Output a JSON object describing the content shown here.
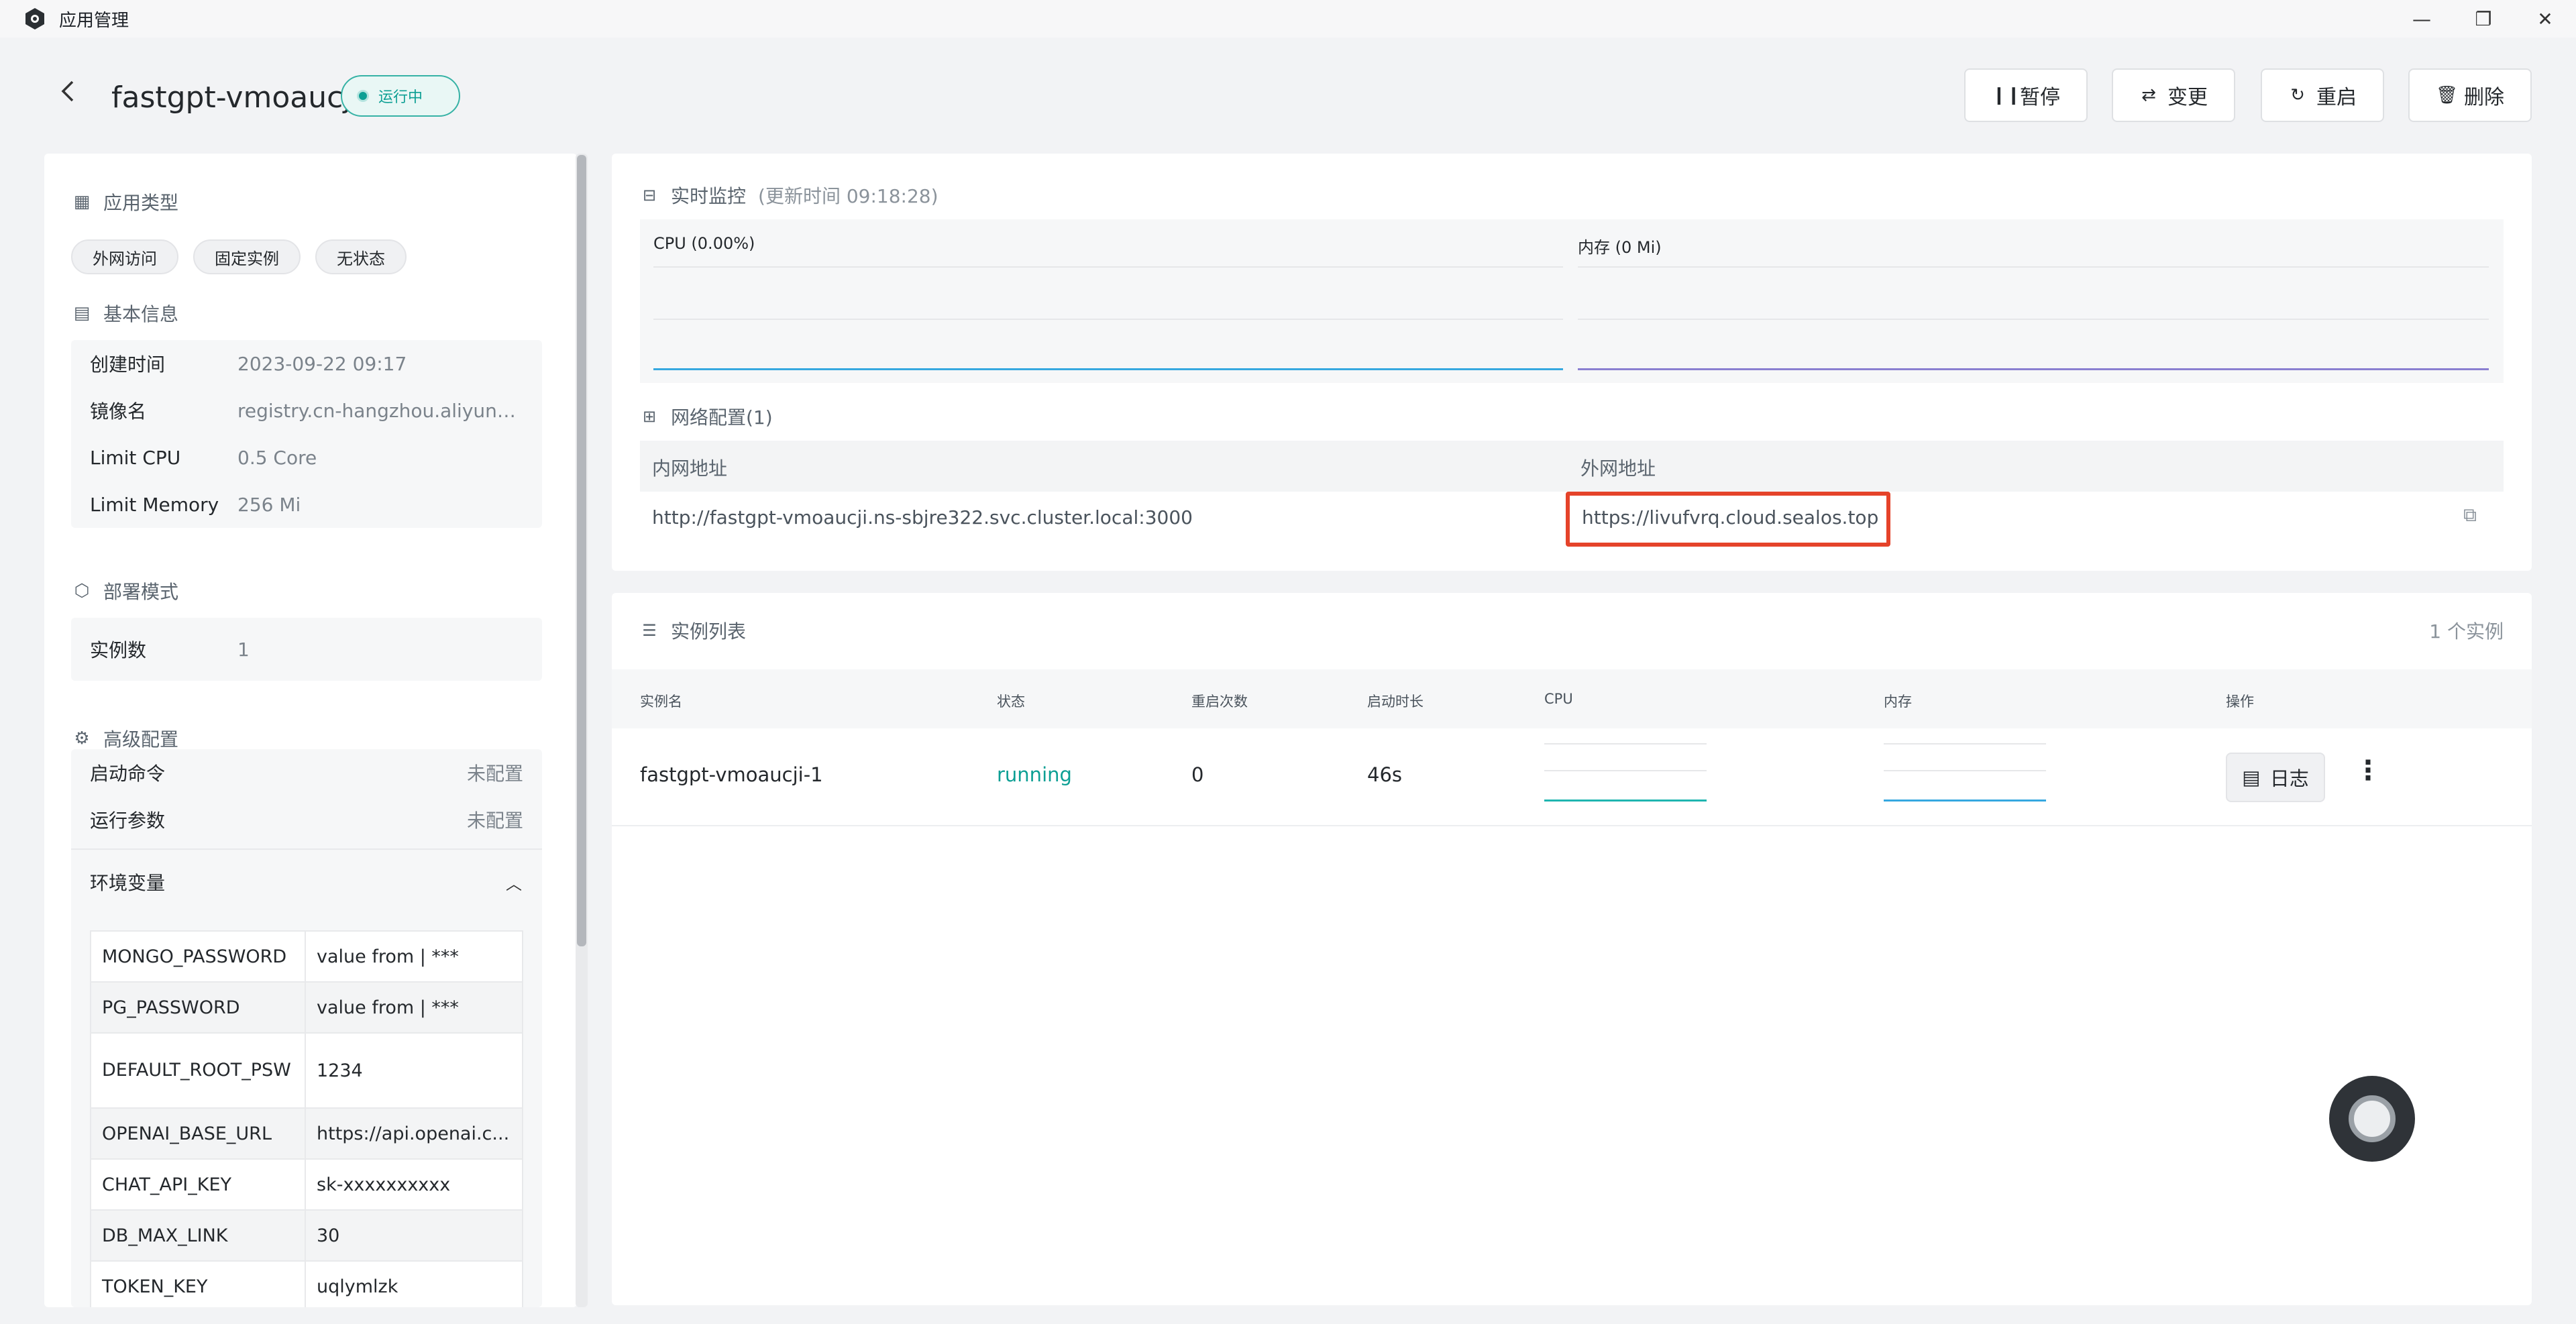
{
  "window": {
    "title": "应用管理",
    "controls": [
      "—",
      "❐",
      "✕"
    ]
  },
  "app": {
    "name": "fastgpt-vmoaucji",
    "status": "运行中"
  },
  "header_buttons": [
    {
      "name": "pause-button",
      "icon": "pause-icon",
      "glyph": "❙❙",
      "label": "暂停"
    },
    {
      "name": "change-button",
      "icon": "swap-icon",
      "glyph": "⇄",
      "label": "变更"
    },
    {
      "name": "restart-button",
      "icon": "restart-icon",
      "glyph": "↻",
      "label": "重启"
    },
    {
      "name": "delete-button",
      "icon": "trash-icon",
      "glyph": "🗑",
      "label": "删除"
    }
  ],
  "left": {
    "app_type": {
      "title": "应用类型",
      "tags": [
        "外网访问",
        "固定实例",
        "无状态"
      ]
    },
    "basic_info": {
      "title": "基本信息",
      "rows": [
        {
          "k": "创建时间",
          "v": "2023-09-22 09:17"
        },
        {
          "k": "镜像名",
          "v": "registry.cn-hangzhou.aliyuncs..."
        },
        {
          "k": "Limit CPU",
          "v": "0.5 Core"
        },
        {
          "k": "Limit Memory",
          "v": "256 Mi"
        }
      ]
    },
    "deploy": {
      "title": "部署模式",
      "rows": [
        {
          "k": "实例数",
          "v": "1"
        }
      ]
    },
    "advanced": {
      "title": "高级配置",
      "rows": [
        {
          "k": "启动命令",
          "v": "未配置"
        },
        {
          "k": "运行参数",
          "v": "未配置"
        }
      ],
      "env_title": "环境变量",
      "env": [
        {
          "k": "MONGO_PASSWORD",
          "v": "value from | ***"
        },
        {
          "k": "PG_PASSWORD",
          "v": "value from | ***"
        },
        {
          "k": "DEFAULT_ROOT_PSW",
          "v": "1234"
        },
        {
          "k": "OPENAI_BASE_URL",
          "v": "https://api.openai.c..."
        },
        {
          "k": "CHAT_API_KEY",
          "v": "sk-xxxxxxxxxx"
        },
        {
          "k": "DB_MAX_LINK",
          "v": "30"
        },
        {
          "k": "TOKEN_KEY",
          "v": "uqlymlzk"
        }
      ]
    }
  },
  "monitor": {
    "title": "实时监控",
    "updated": "(更新时间 09:18:28)",
    "cpu_label": "CPU  (0.00%)",
    "mem_label": "内存  (0 Mi)",
    "cpu_color": "#36a8e0",
    "mem_color": "#8a7fd1"
  },
  "network": {
    "title": "网络配置(1)",
    "internal_head": "内网地址",
    "external_head": "外网地址",
    "internal": "http://fastgpt-vmoaucji.ns-sbjre322.svc.cluster.local:3000",
    "external": "https://livufvrq.cloud.sealos.top",
    "highlight_color": "#e5432a"
  },
  "instances": {
    "title": "实例列表",
    "count": "1 个实例",
    "headers": [
      "实例名",
      "状态",
      "重启次数",
      "启动时长",
      "CPU",
      "内存",
      "操作"
    ],
    "rows": [
      {
        "name": "fastgpt-vmoaucji-1",
        "status": "running",
        "restarts": "0",
        "uptime": "46s",
        "log": "日志"
      }
    ],
    "status_color": "#0d9f94"
  }
}
